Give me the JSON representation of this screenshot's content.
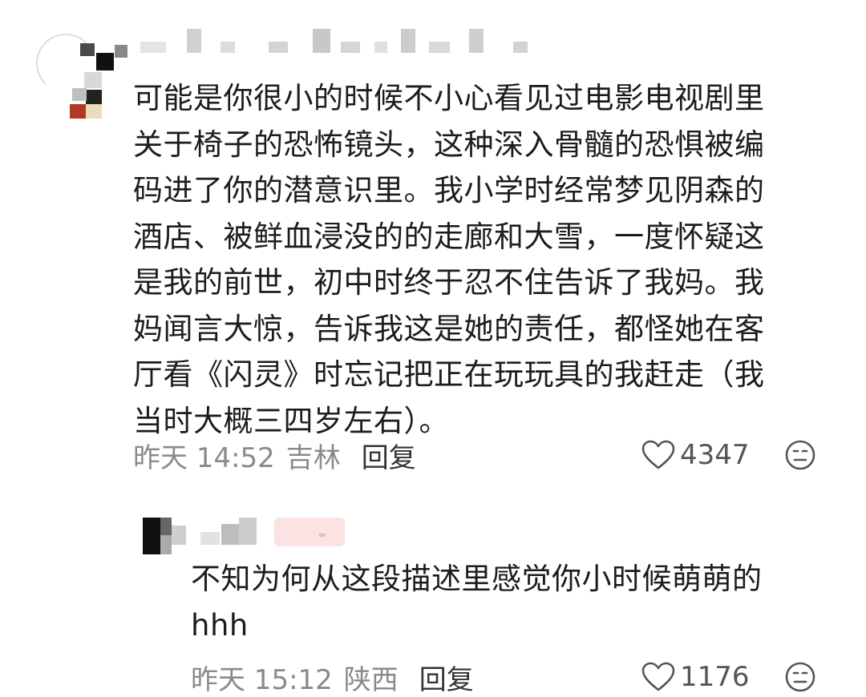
{
  "comments": [
    {
      "lines": [
        "可能是你很小的时候不小心看见过电影电视剧里",
        "关于椅子的恐怖镜头，这种深入骨髓的恐惧被编",
        "码进了你的潜意识里。我小学时经常梦见阴森的",
        "酒店、被鲜血浸没的的走廊和大雪，一度怀疑这",
        "是我的前世，初中时终于忍不住告诉了我妈。我",
        "妈闻言大惊，告诉我这是她的责任，都怪她在客",
        "厅看《闪灵》时忘记把正在玩玩具的我赶走（我",
        "当时大概三四岁左右）。"
      ],
      "time": "昨天 14:52",
      "location": "吉林",
      "reply_label": "回复",
      "likes": "4347"
    },
    {
      "lines": [
        "不知为何从这段描述里感觉你小时候萌萌的",
        "hhh"
      ],
      "time": "昨天 15:12",
      "location": "陕西",
      "reply_label": "回复",
      "likes": "1176"
    }
  ],
  "icons": {
    "like": "heart-outline-icon",
    "react": "meh-face-icon"
  },
  "colors": {
    "text": "#1c1c1c",
    "meta": "#8a8a8a",
    "icon": "#555555"
  }
}
